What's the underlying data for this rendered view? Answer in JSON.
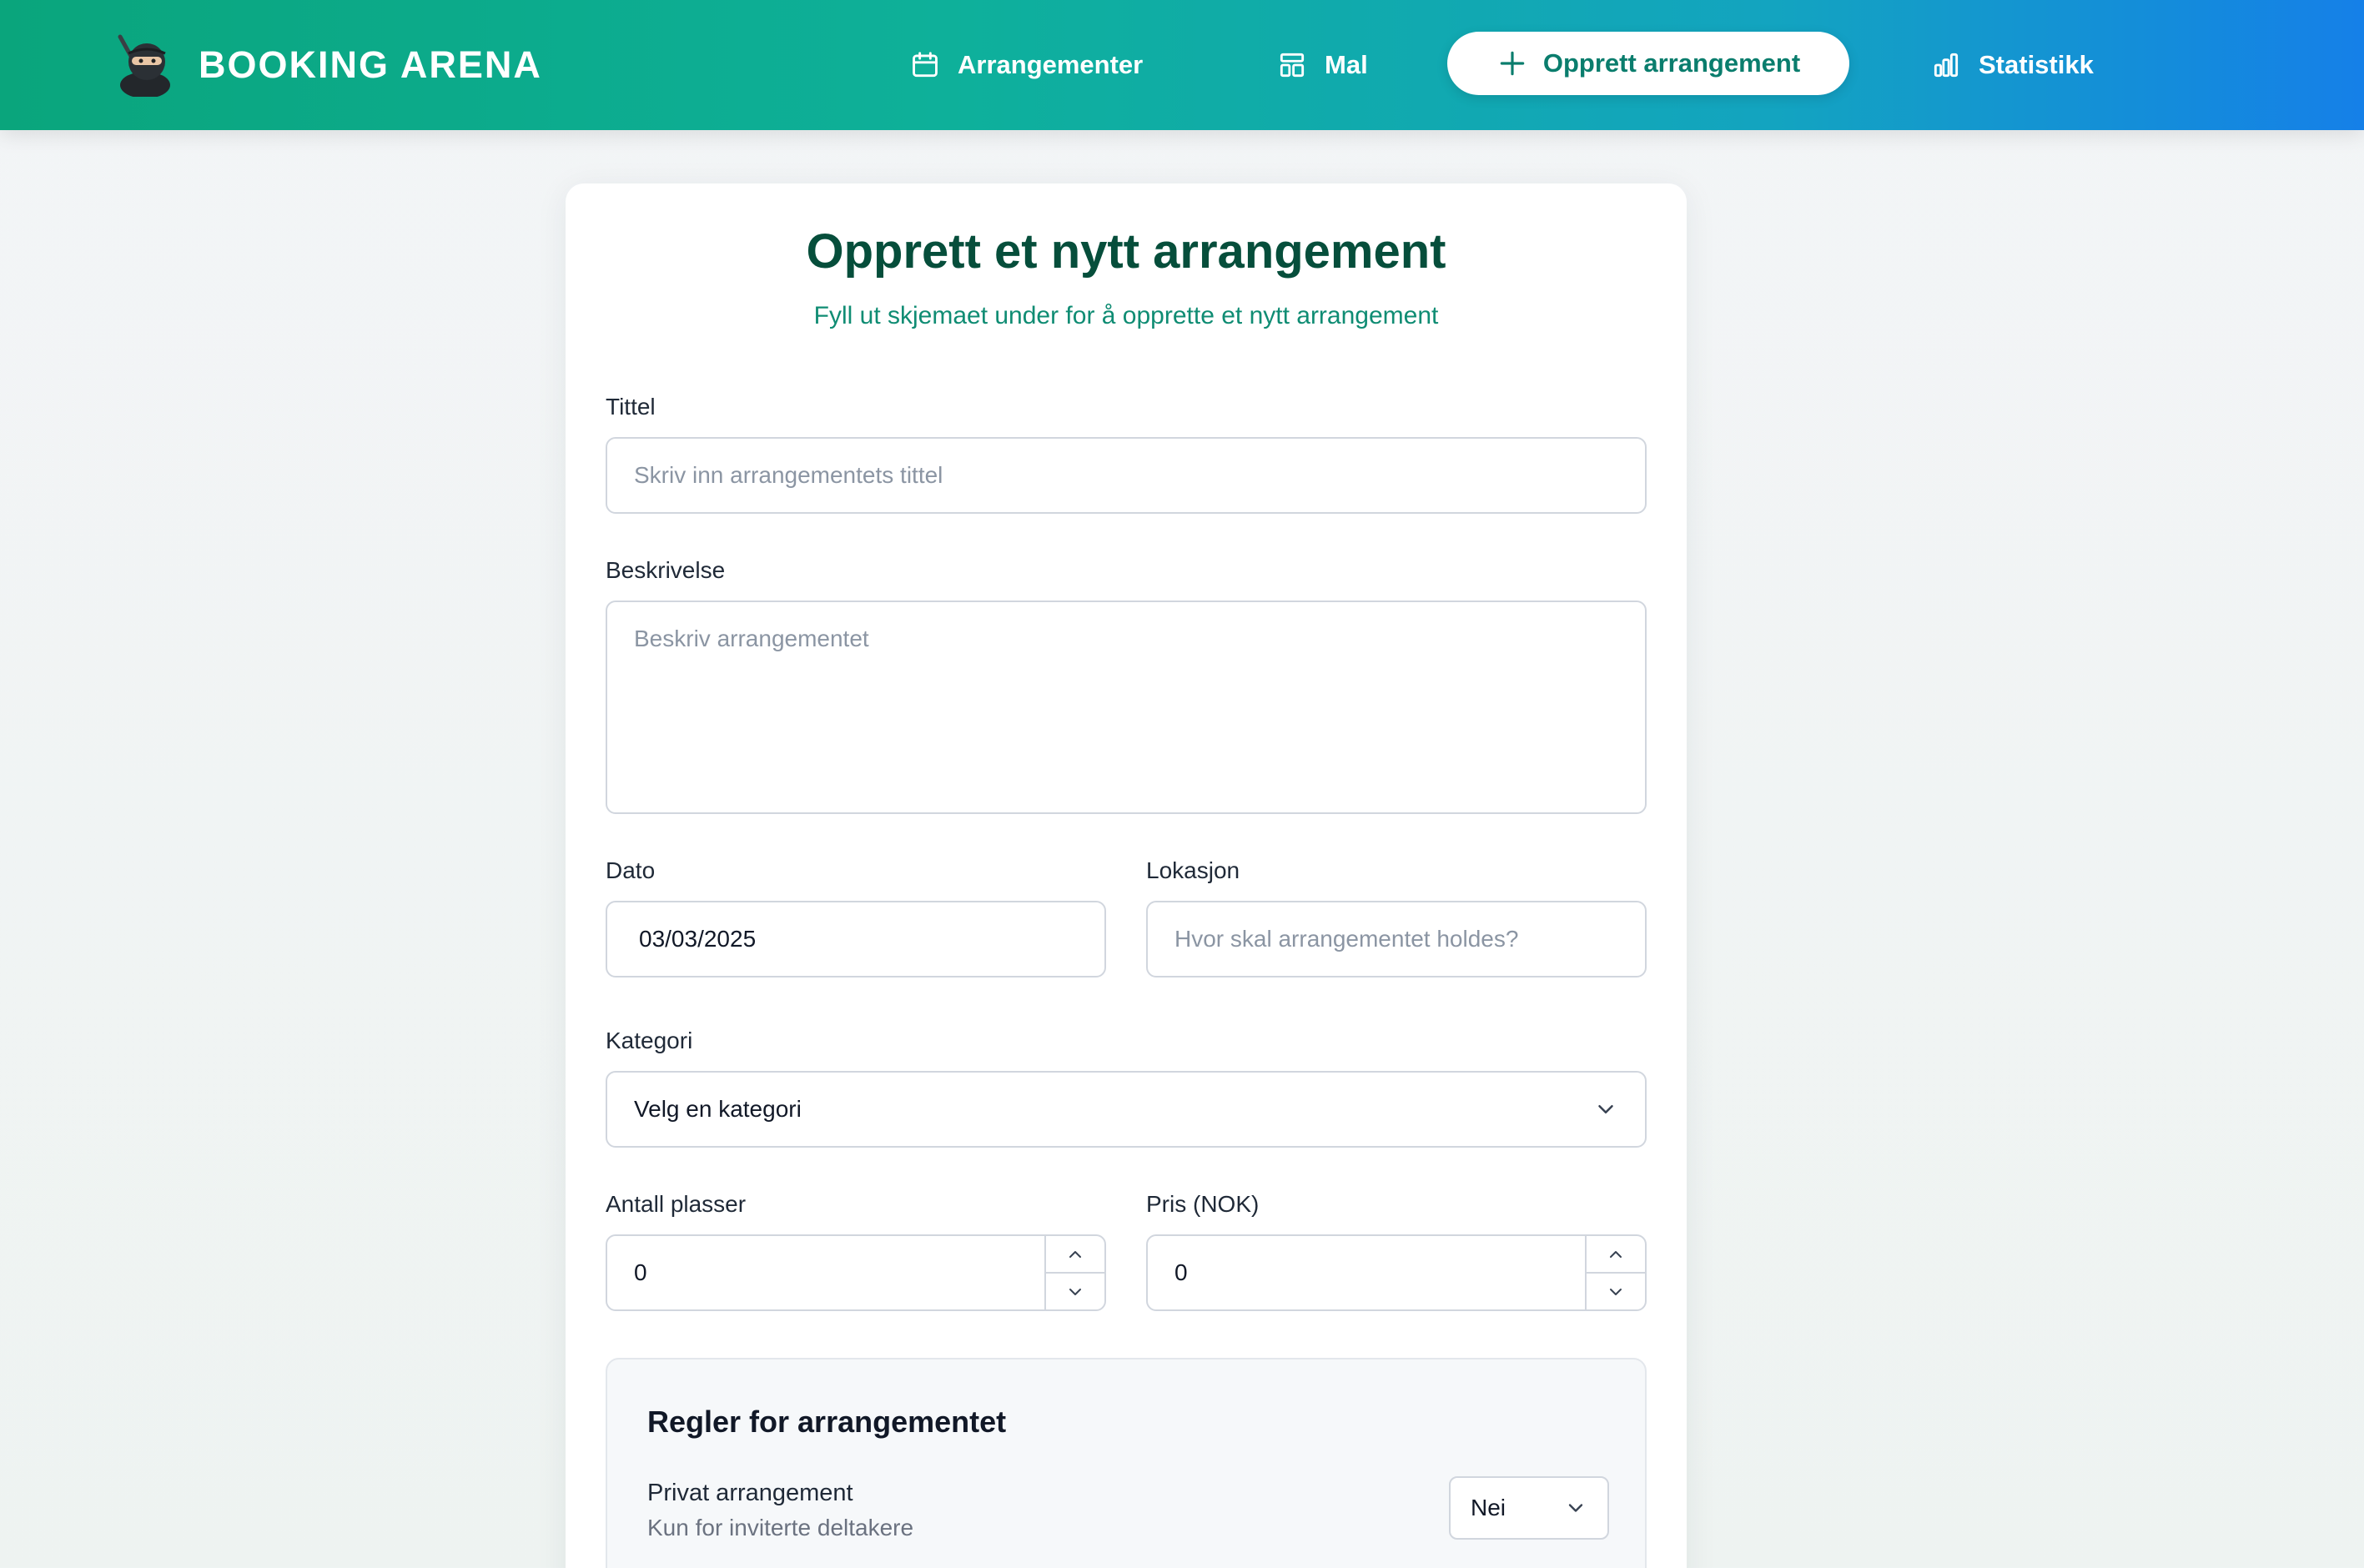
{
  "nav": {
    "brand": "BOOKING ARENA",
    "items": [
      {
        "label": "Arrangementer",
        "icon": "calendar-icon"
      },
      {
        "label": "Mal",
        "icon": "template-icon"
      },
      {
        "label": "Opprett arrangement",
        "icon": "plus-icon",
        "active": true
      },
      {
        "label": "Statistikk",
        "icon": "bar-chart-icon"
      }
    ],
    "colors": {
      "gradient_start": "#0aa57c",
      "gradient_end": "#1580e8"
    }
  },
  "form": {
    "title": "Opprett et nytt arrangement",
    "subtitle": "Fyll ut skjemaet under for å opprette et nytt arrangement",
    "tittel": {
      "label": "Tittel",
      "placeholder": "Skriv inn arrangementets tittel",
      "value": ""
    },
    "beskrivelse": {
      "label": "Beskrivelse",
      "placeholder": "Beskriv arrangementet",
      "value": ""
    },
    "dato": {
      "label": "Dato",
      "value": "03/03/2025"
    },
    "lokasjon": {
      "label": "Lokasjon",
      "placeholder": "Hvor skal arrangementet holdes?",
      "value": ""
    },
    "kategori": {
      "label": "Kategori",
      "value": "Velg en kategori"
    },
    "antall_plasser": {
      "label": "Antall plasser",
      "value": "0"
    },
    "pris": {
      "label": "Pris (NOK)",
      "value": "0"
    }
  },
  "rules": {
    "title": "Regler for arrangementet",
    "private": {
      "label": "Privat arrangement",
      "description": "Kun for inviterte deltakere",
      "value": "Nei"
    }
  }
}
